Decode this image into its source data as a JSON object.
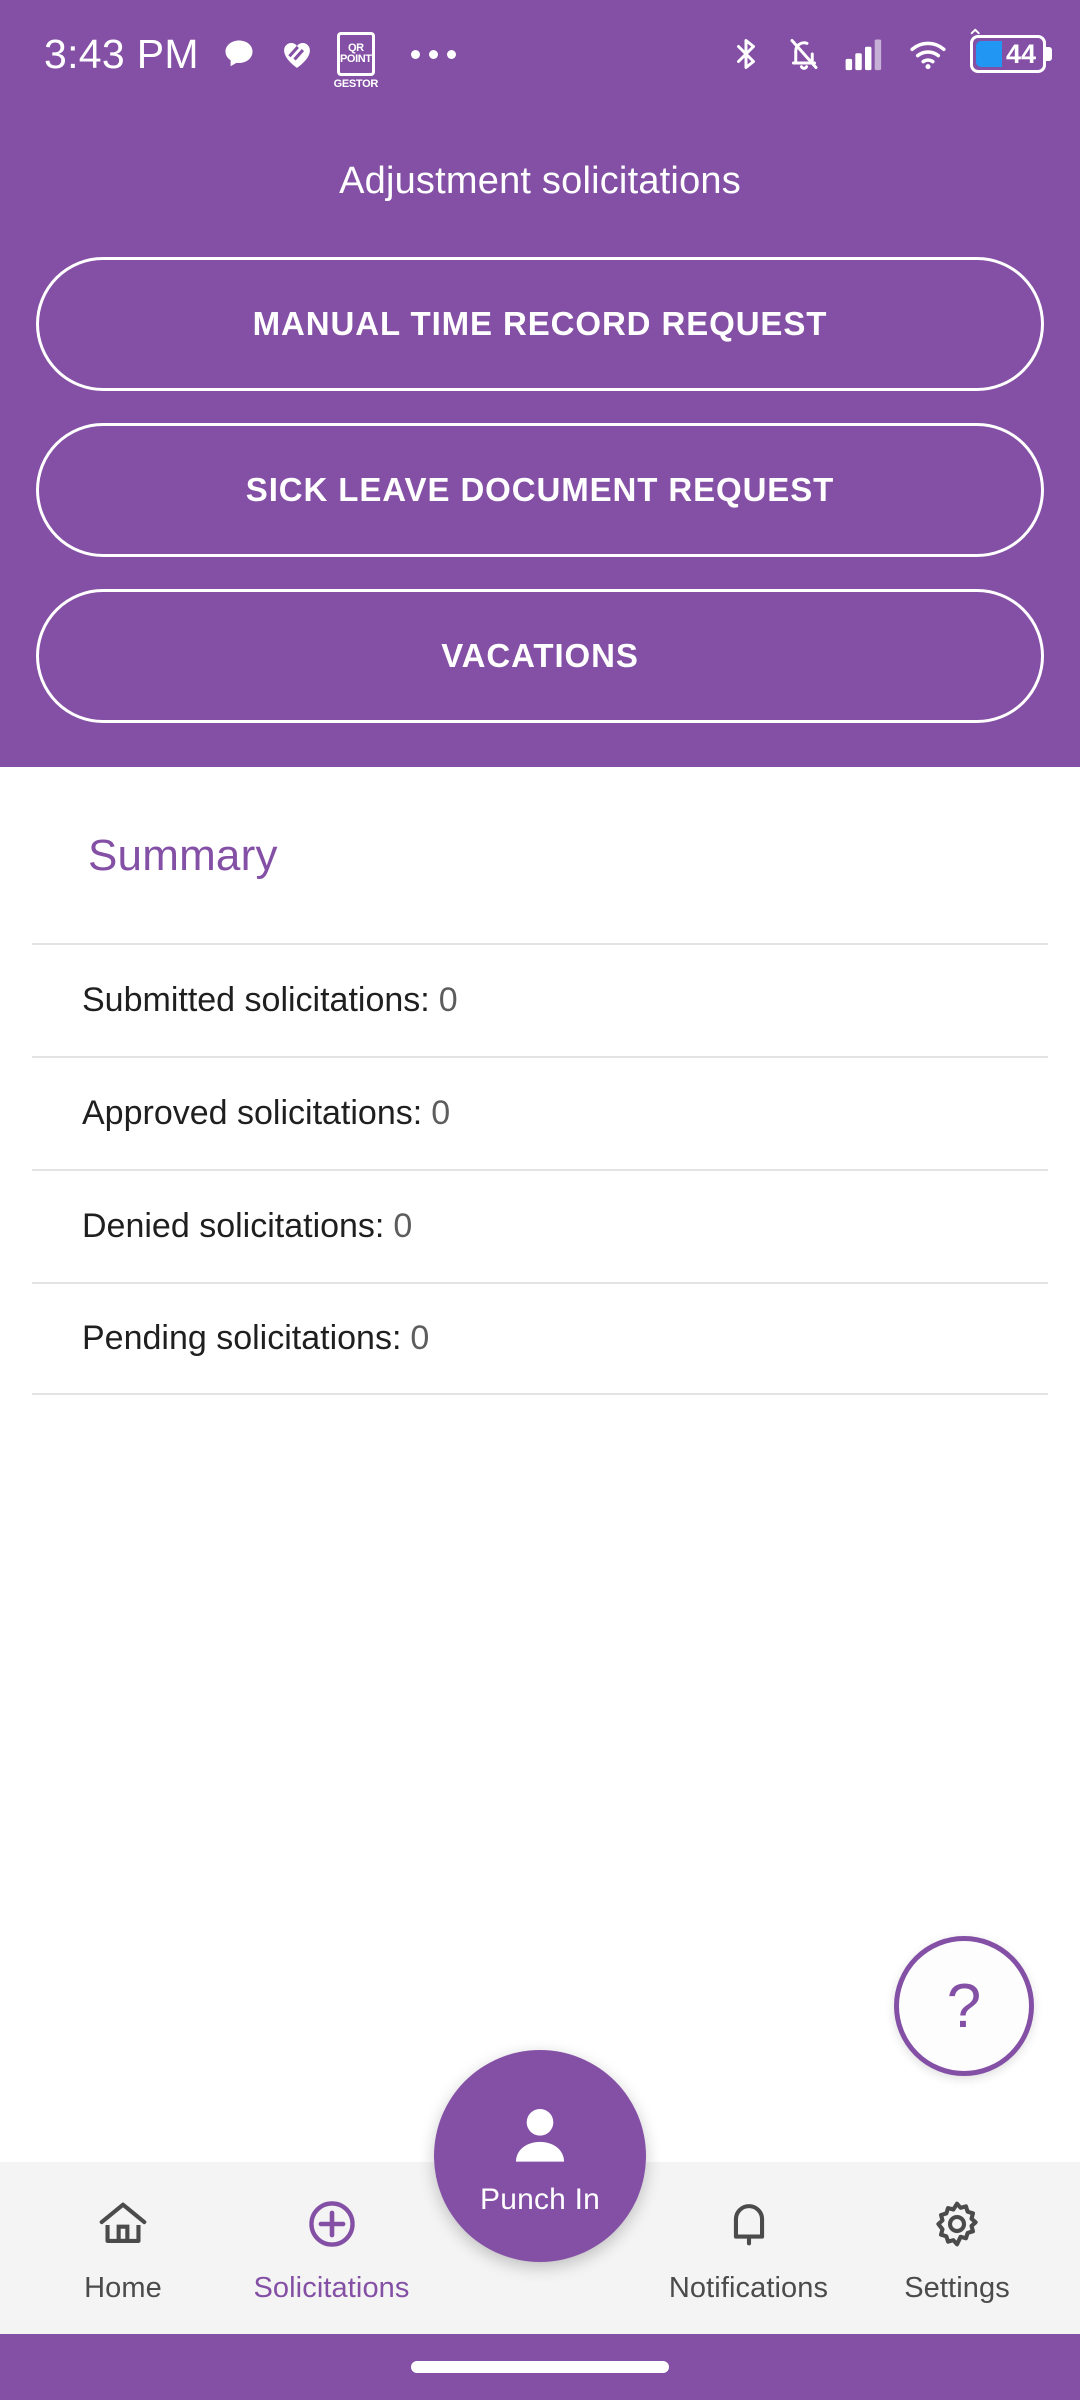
{
  "status_bar": {
    "time": "3:43 PM",
    "icons_left": [
      "chat-bubble-icon",
      "heart-stripe-icon",
      "qr-point-gestor-badge",
      "overflow-dots-icon"
    ],
    "qr_badge": {
      "line1": "QR",
      "line2": "POINT",
      "sub": "GESTOR"
    },
    "icons_right": [
      "bluetooth-icon",
      "notification-muted-icon",
      "signal-bars-icon",
      "wifi-icon",
      "battery-icon"
    ],
    "battery_level": "44"
  },
  "header": {
    "title": "Adjustment solicitations",
    "buttons": [
      {
        "label": "MANUAL TIME RECORD REQUEST"
      },
      {
        "label": "SICK LEAVE DOCUMENT REQUEST"
      },
      {
        "label": "VACATIONS"
      }
    ]
  },
  "summary": {
    "title": "Summary",
    "rows": [
      {
        "label": "Submitted solicitations:",
        "value": "0"
      },
      {
        "label": "Approved solicitations:",
        "value": "0"
      },
      {
        "label": "Denied solicitations:",
        "value": "0"
      },
      {
        "label": "Pending solicitations:",
        "value": "0"
      }
    ]
  },
  "help_button": {
    "label": "?"
  },
  "punch_button": {
    "label": "Punch In",
    "icon": "person-icon"
  },
  "bottom_nav": {
    "items": [
      {
        "label": "Home",
        "icon": "home-icon",
        "active": false
      },
      {
        "label": "Solicitations",
        "icon": "plus-circle-icon",
        "active": true
      },
      {
        "label": "Notifications",
        "icon": "bell-icon",
        "active": false
      },
      {
        "label": "Settings",
        "icon": "gear-icon",
        "active": false
      }
    ]
  },
  "colors": {
    "brand_purple": "#8450a5",
    "nav_background": "#f4f4f4",
    "battery_fill": "#2196f3",
    "divider": "#e3e3e3"
  }
}
